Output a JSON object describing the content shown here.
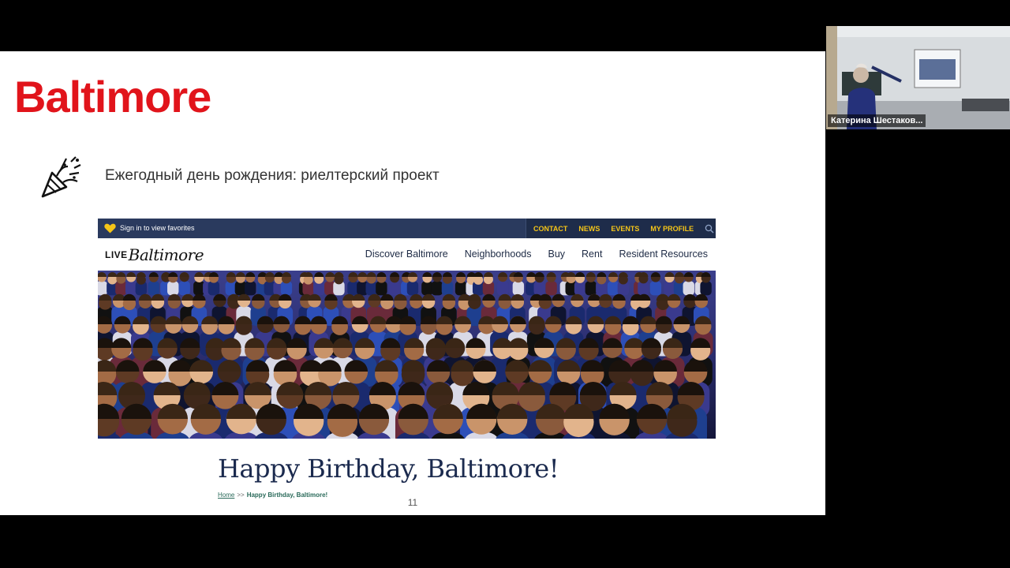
{
  "slide": {
    "title": "Baltimore",
    "bullet_text": "Ежегодный день рождения: риелтерский проект",
    "bullet_icon": "party-popper-icon",
    "page_number": "11"
  },
  "website": {
    "favorites_text": "Sign in to view favorites",
    "utility_nav": [
      "CONTACT",
      "NEWS",
      "EVENTS",
      "MY PROFILE"
    ],
    "logo": {
      "prefix": "LIVE",
      "city": "Baltimore"
    },
    "main_nav": [
      "Discover Baltimore",
      "Neighborhoods",
      "Buy",
      "Rent",
      "Resident Resources"
    ],
    "heading": "Happy Birthday, Baltimore!",
    "breadcrumb": {
      "home": "Home",
      "separator": ">>",
      "current": "Happy Birthday, Baltimore!"
    },
    "colors": {
      "topbar": "#2a3a5e",
      "accent": "#f5c518",
      "heading": "#1b2a4e"
    }
  },
  "presenter": {
    "name": "Катерина Шестаков..."
  },
  "colors": {
    "title_red": "#e1141b",
    "background": "#000000"
  }
}
